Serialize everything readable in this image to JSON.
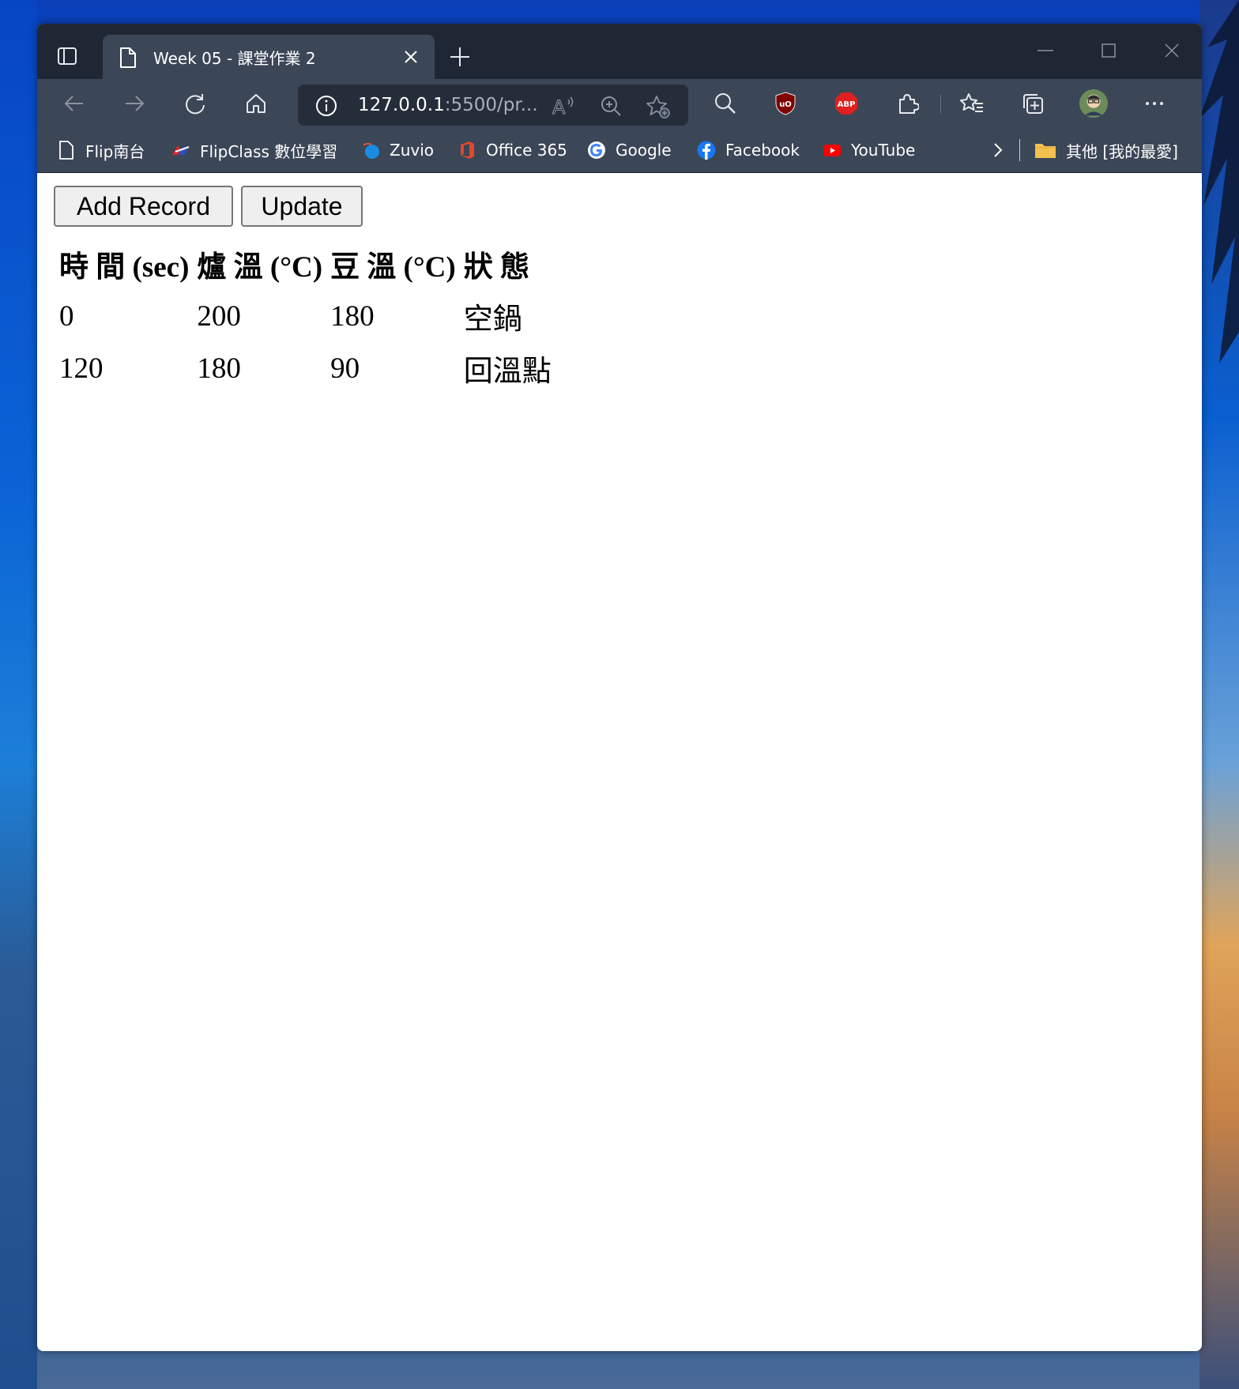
{
  "browser": {
    "tab_title": "Week 05 - 課堂作業 2",
    "address_host": "127.0.0.1",
    "address_rest": ":5500/pr...",
    "bookmarks": [
      "Flip南台",
      "FlipClass 數位學習",
      "Zuvio",
      "Office 365",
      "Google",
      "Facebook",
      "YouTube"
    ],
    "other_favorites": "其他 [我的最愛]",
    "extensions": {
      "abp_label": "ABP",
      "ublock_label": "uO"
    }
  },
  "page": {
    "add_record_label": "Add Record",
    "update_label": "Update",
    "table": {
      "headers": [
        "時 間 (sec)",
        "爐 溫 (°C)",
        "豆 溫 (°C)",
        "狀 態"
      ],
      "rows": [
        [
          "0",
          "200",
          "180",
          "空鍋"
        ],
        [
          "120",
          "180",
          "90",
          "回溫點"
        ]
      ]
    }
  }
}
